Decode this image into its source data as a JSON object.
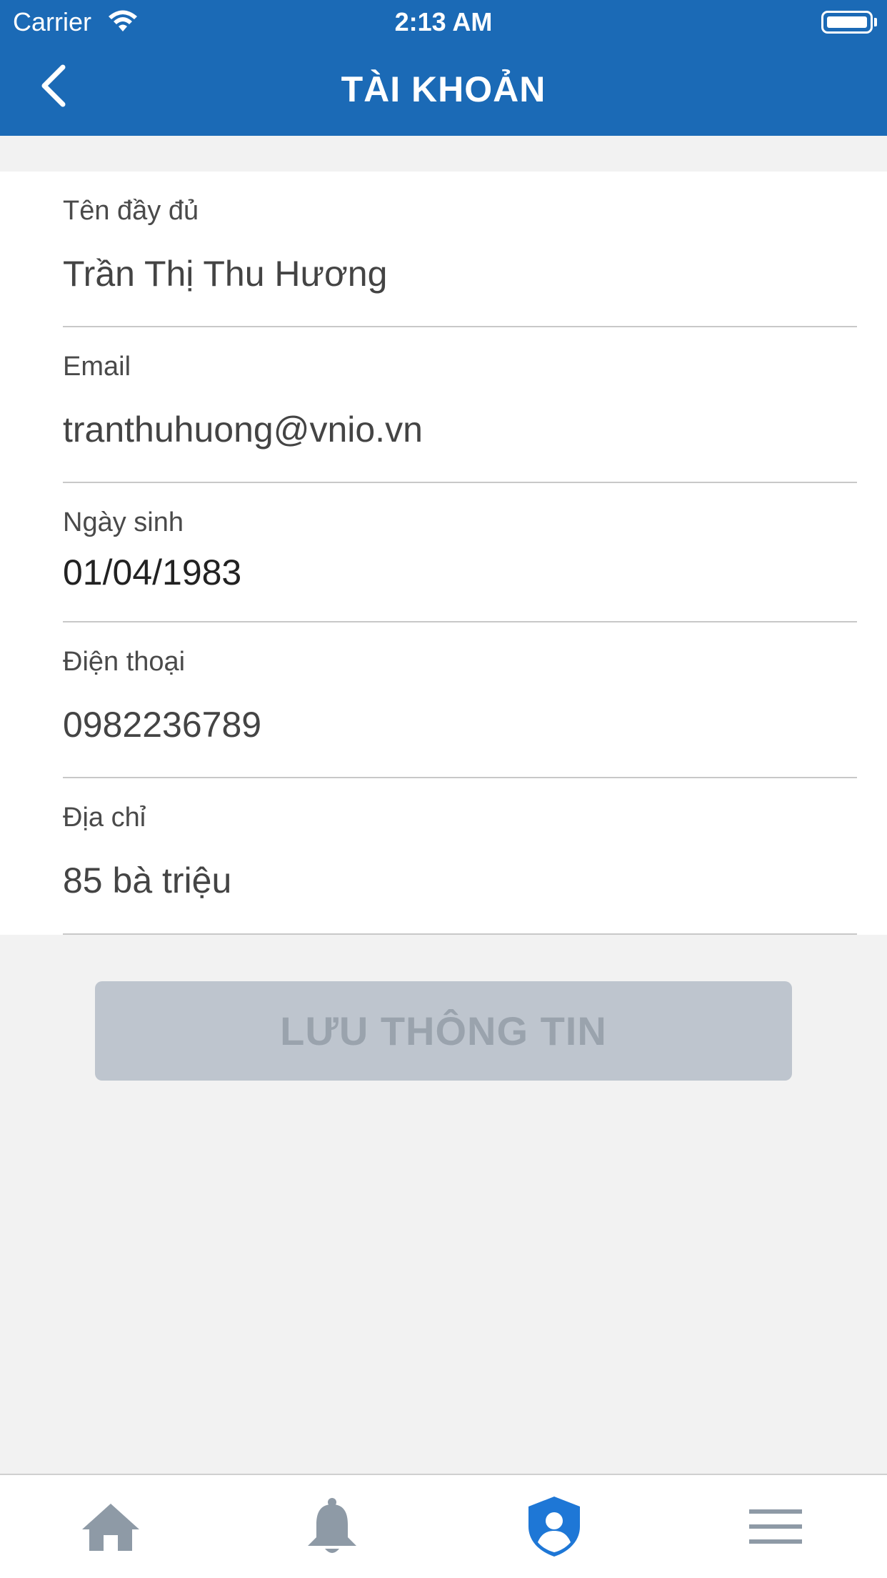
{
  "status_bar": {
    "carrier": "Carrier",
    "time": "2:13 AM"
  },
  "nav": {
    "title": "TÀI KHOẢN",
    "back_icon": "chevron-left-icon"
  },
  "form": {
    "fields": [
      {
        "label": "Tên đầy đủ",
        "value": "Trần Thị Thu Hương"
      },
      {
        "label": "Email",
        "value": "tranthuhuong@vnio.vn"
      },
      {
        "label": "Ngày sinh",
        "value": "01/04/1983"
      },
      {
        "label": "Điện thoại",
        "value": "0982236789"
      },
      {
        "label": "Địa chỉ",
        "value": "85 bà triệu"
      }
    ]
  },
  "save_button": {
    "label": "LƯU THÔNG TIN",
    "state": "disabled"
  },
  "tab_bar": {
    "items": [
      {
        "icon": "home-icon",
        "active": false
      },
      {
        "icon": "bell-icon",
        "active": false
      },
      {
        "icon": "user-shield-icon",
        "active": true
      },
      {
        "icon": "menu-icon",
        "active": false
      }
    ]
  },
  "colors": {
    "brand_blue": "#1b6ab6",
    "active_tab": "#1e77d6",
    "inactive_tab": "#8e9aa6",
    "disabled_button": "#bec5ce"
  }
}
